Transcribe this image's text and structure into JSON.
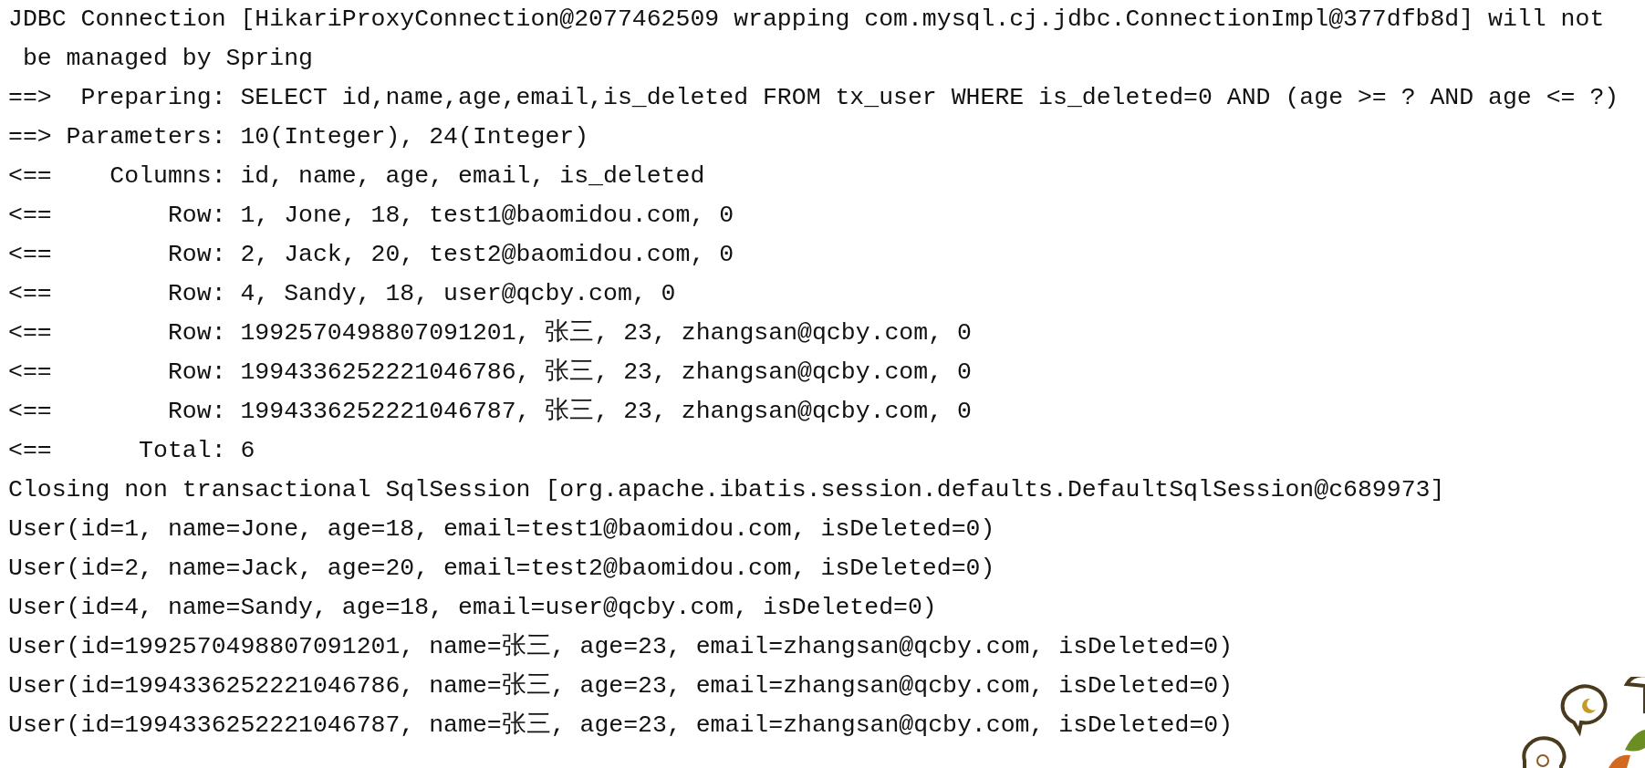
{
  "console": {
    "lines": [
      "JDBC Connection [HikariProxyConnection@2077462509 wrapping com.mysql.cj.jdbc.ConnectionImpl@377dfb8d] will not",
      " be managed by Spring",
      "==>  Preparing: SELECT id,name,age,email,is_deleted FROM tx_user WHERE is_deleted=0 AND (age >= ? AND age <= ?)",
      "==> Parameters: 10(Integer), 24(Integer)",
      "<==    Columns: id, name, age, email, is_deleted",
      "<==        Row: 1, Jone, 18, test1@baomidou.com, 0",
      "<==        Row: 2, Jack, 20, test2@baomidou.com, 0",
      "<==        Row: 4, Sandy, 18, user@qcby.com, 0",
      "<==        Row: 1992570498807091201, 张三, 23, zhangsan@qcby.com, 0",
      "<==        Row: 1994336252221046786, 张三, 23, zhangsan@qcby.com, 0",
      "<==        Row: 1994336252221046787, 张三, 23, zhangsan@qcby.com, 0",
      "<==      Total: 6",
      "Closing non transactional SqlSession [org.apache.ibatis.session.defaults.DefaultSqlSession@c689973]",
      "User(id=1, name=Jone, age=18, email=test1@baomidou.com, isDeleted=0)",
      "User(id=2, name=Jack, age=20, email=test2@baomidou.com, isDeleted=0)",
      "User(id=4, name=Sandy, age=18, email=user@qcby.com, isDeleted=0)",
      "User(id=1992570498807091201, name=张三, age=23, email=zhangsan@qcby.com, isDeleted=0)",
      "User(id=1994336252221046786, name=张三, age=23, email=zhangsan@qcby.com, isDeleted=0)",
      "User(id=1994336252221046787, name=张三, age=23, email=zhangsan@qcby.com, isDeleted=0)"
    ]
  }
}
